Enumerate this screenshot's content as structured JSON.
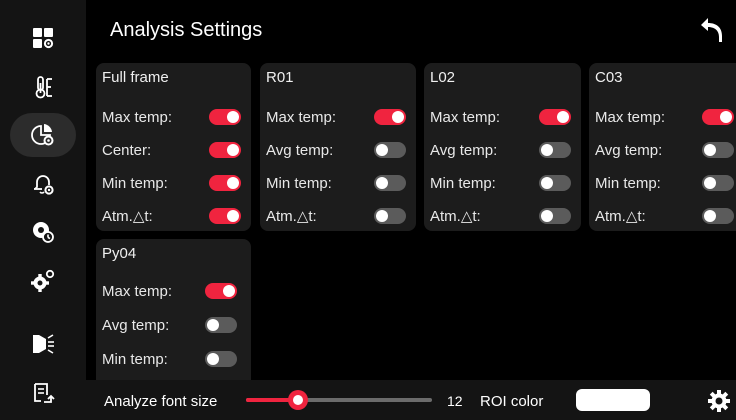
{
  "header": {
    "title": "Analysis Settings"
  },
  "panels": [
    {
      "name": "Full frame",
      "rows": [
        {
          "label": "Max temp:",
          "on": true
        },
        {
          "label": "Center:",
          "on": true
        },
        {
          "label": "Min temp:",
          "on": true
        },
        {
          "label": "Atm.△t:",
          "on": true
        }
      ]
    },
    {
      "name": "R01",
      "rows": [
        {
          "label": "Max temp:",
          "on": true
        },
        {
          "label": "Avg temp:",
          "on": false
        },
        {
          "label": "Min temp:",
          "on": false
        },
        {
          "label": "Atm.△t:",
          "on": false
        }
      ]
    },
    {
      "name": "L02",
      "rows": [
        {
          "label": "Max temp:",
          "on": true
        },
        {
          "label": "Avg temp:",
          "on": false
        },
        {
          "label": "Min temp:",
          "on": false
        },
        {
          "label": "Atm.△t:",
          "on": false
        }
      ]
    },
    {
      "name": "C03",
      "rows": [
        {
          "label": "Max temp:",
          "on": true
        },
        {
          "label": "Avg temp:",
          "on": false
        },
        {
          "label": "Min temp:",
          "on": false
        },
        {
          "label": "Atm.△t:",
          "on": false
        }
      ]
    },
    {
      "name": "Py04",
      "rows": [
        {
          "label": "Max temp:",
          "on": true
        },
        {
          "label": "Avg temp:",
          "on": false
        },
        {
          "label": "Min temp:",
          "on": false
        }
      ]
    }
  ],
  "footer": {
    "font_size_label": "Analyze font size",
    "font_size_value": "12",
    "font_size_fraction": 0.28,
    "roi_color_label": "ROI color",
    "roi_color": "#ffffff"
  },
  "colors": {
    "accent": "#f0243f",
    "toggle_off": "#5b5b5b",
    "card": "#1c1c1c"
  },
  "sidebar": {
    "icons": [
      "layout-icon",
      "thermometer-icon",
      "analysis-settings-icon",
      "alarm-settings-icon",
      "timer-settings-icon",
      "gear-settings-icon",
      "display-settings-icon",
      "report-icon"
    ],
    "active": 2
  }
}
